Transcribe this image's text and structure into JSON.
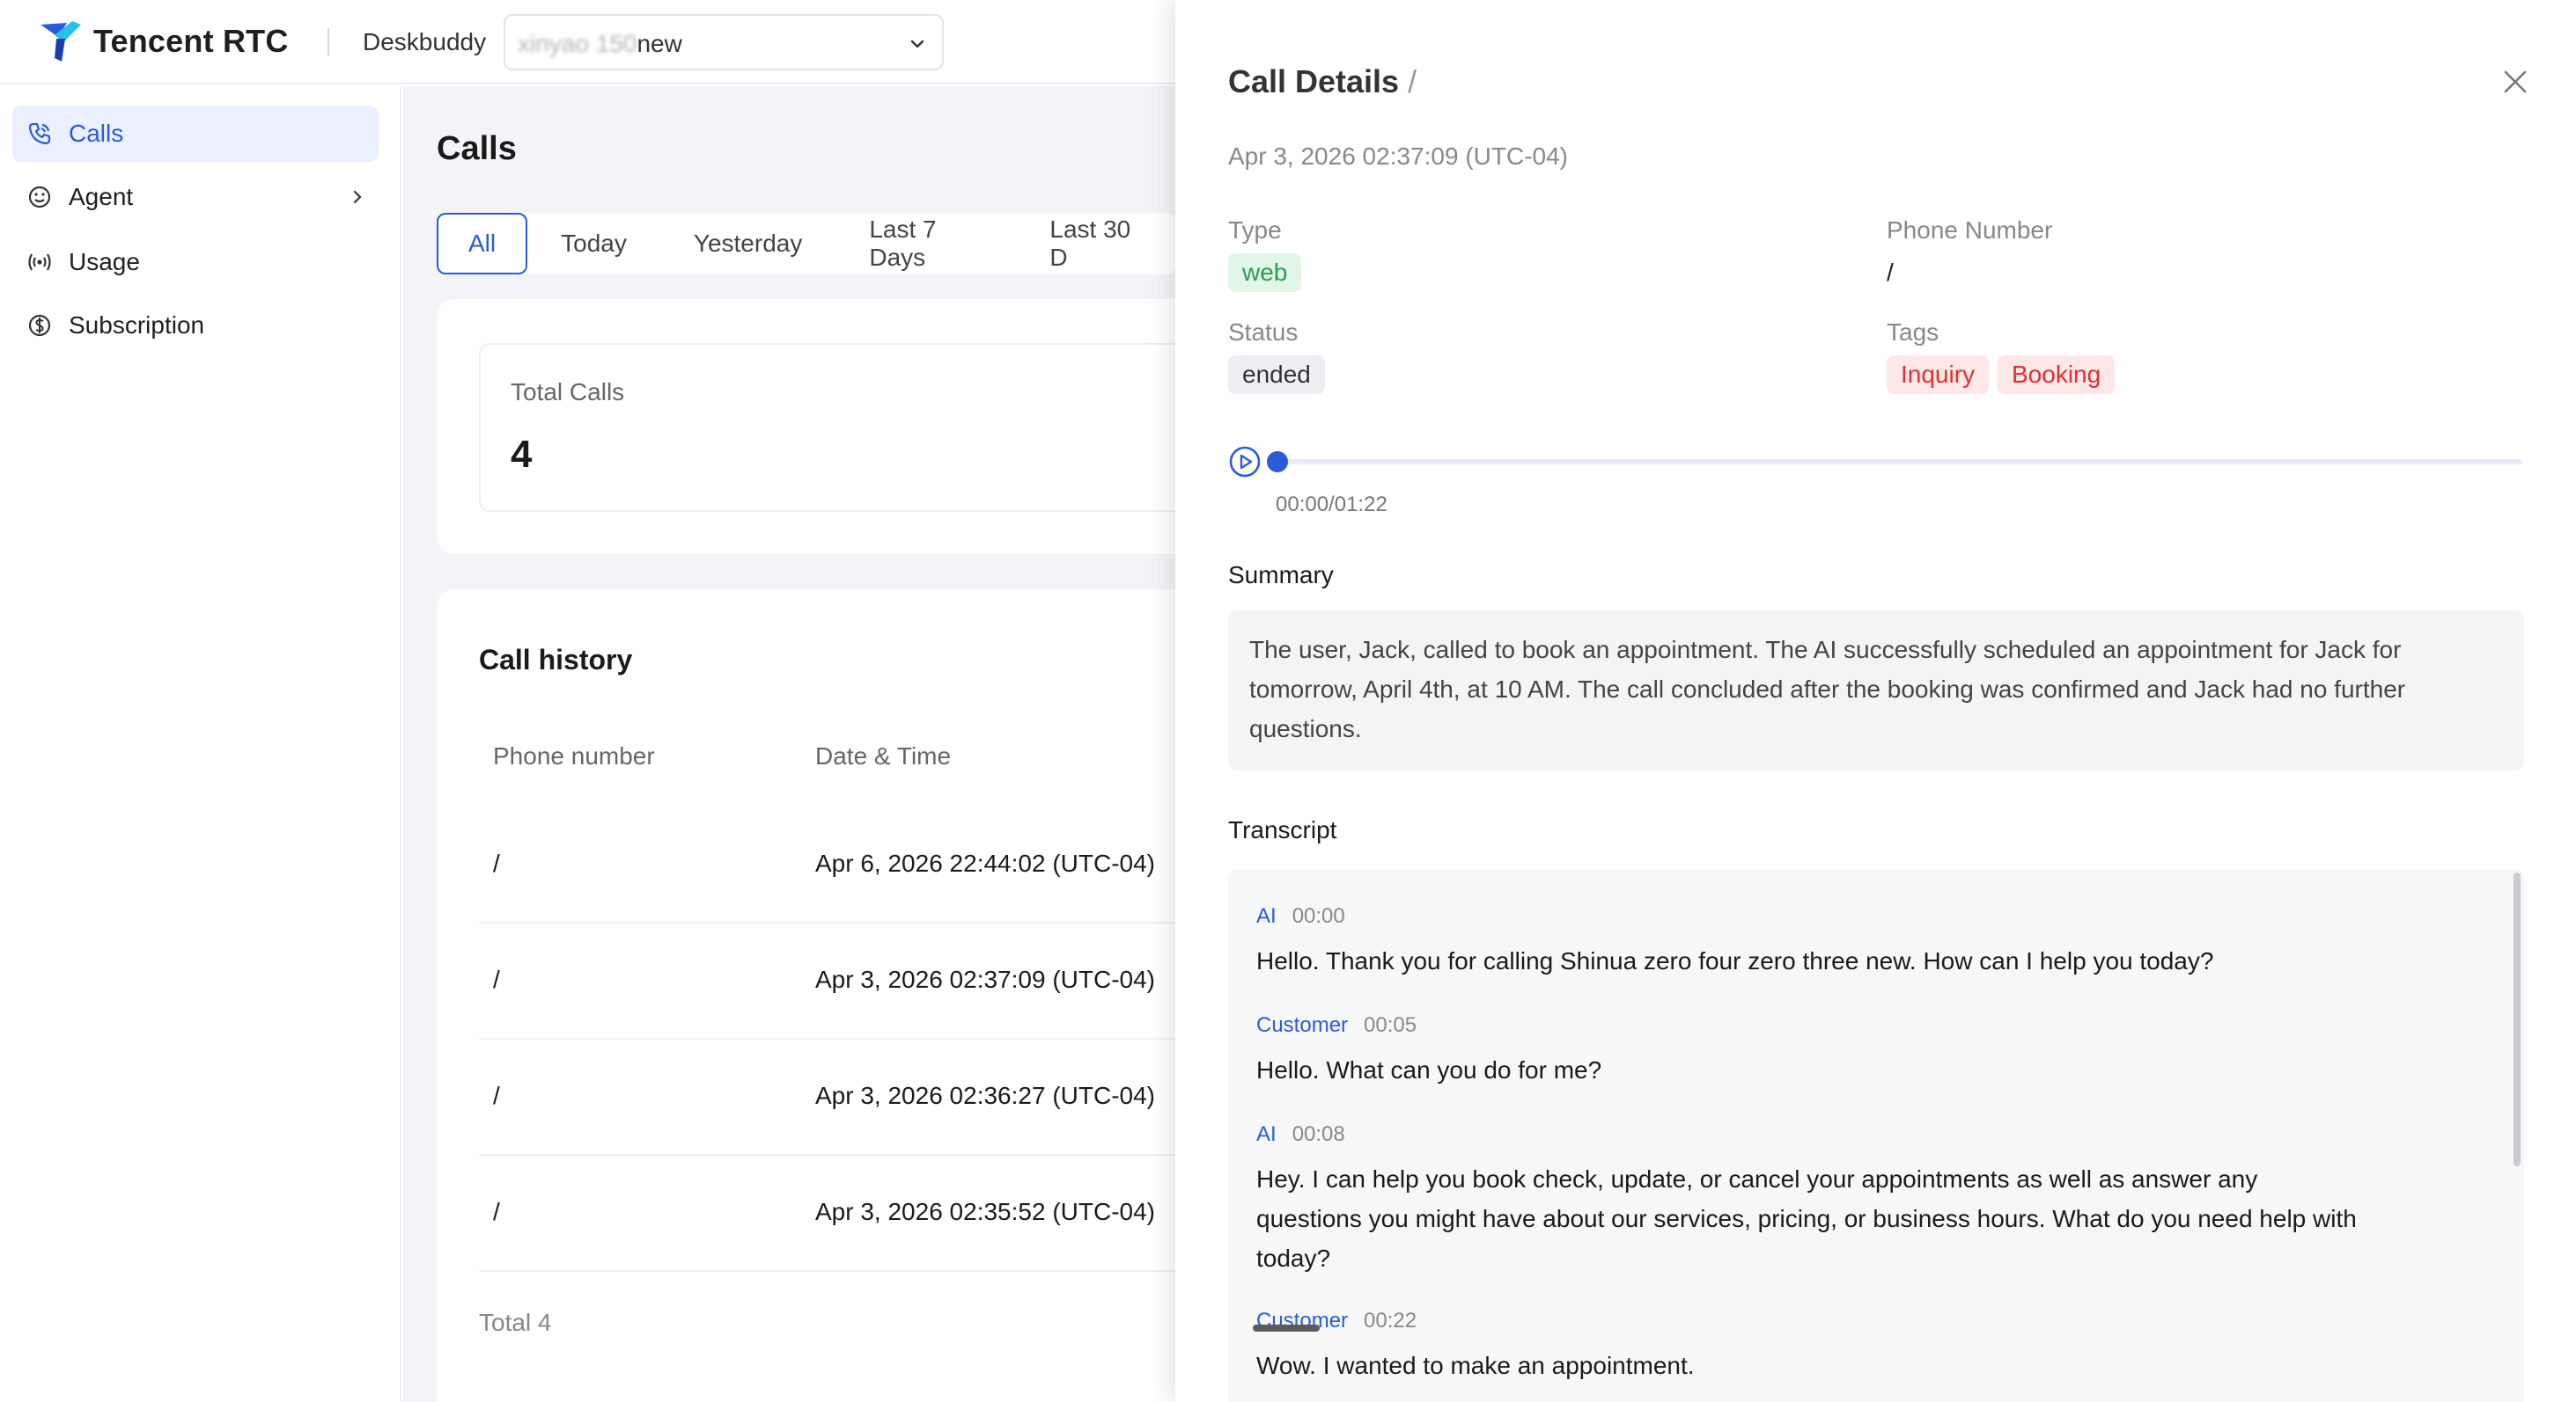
{
  "header": {
    "brand": "Tencent RTC",
    "workspace_label": "Deskbuddy",
    "workspace_value_obscured": "xinyao 150",
    "workspace_value_suffix": "new"
  },
  "sidebar": {
    "items": [
      {
        "label": "Calls",
        "icon": "phone-icon",
        "active": true
      },
      {
        "label": "Agent",
        "icon": "smiley-icon",
        "has_submenu": true
      },
      {
        "label": "Usage",
        "icon": "broadcast-icon"
      },
      {
        "label": "Subscription",
        "icon": "dollar-icon"
      }
    ]
  },
  "main": {
    "title": "Calls",
    "tabs": [
      "All",
      "Today",
      "Yesterday",
      "Last 7 Days",
      "Last 30 D"
    ],
    "active_tab": "All",
    "stats": {
      "total_calls_label": "Total Calls",
      "total_calls_value": "4"
    },
    "history": {
      "title": "Call history",
      "columns": [
        "Phone number",
        "Date & Time"
      ],
      "rows": [
        {
          "phone": "/",
          "datetime": "Apr 6, 2026 22:44:02 (UTC-04)"
        },
        {
          "phone": "/",
          "datetime": "Apr 3, 2026 02:37:09 (UTC-04)"
        },
        {
          "phone": "/",
          "datetime": "Apr 3, 2026 02:36:27 (UTC-04)"
        },
        {
          "phone": "/",
          "datetime": "Apr 3, 2026 02:35:52 (UTC-04)"
        }
      ],
      "total": "Total 4"
    }
  },
  "drawer": {
    "title": "Call Details",
    "title_suffix": "/",
    "datetime": "Apr 3, 2026 02:37:09 (UTC-04)",
    "type_label": "Type",
    "type_value": "web",
    "phone_label": "Phone Number",
    "phone_value": "/",
    "status_label": "Status",
    "status_value": "ended",
    "tags_label": "Tags",
    "tags": [
      "Inquiry",
      "Booking"
    ],
    "player": {
      "time": "00:00/01:22",
      "progress": 0
    },
    "summary_heading": "Summary",
    "summary": "The user, Jack, called to book an appointment. The AI successfully scheduled an appointment for Jack for tomorrow, April 4th, at 10 AM. The call concluded after the booking was confirmed and Jack had no further questions.",
    "transcript_heading": "Transcript",
    "transcript": [
      {
        "speaker": "AI",
        "time": "00:00",
        "text": "Hello. Thank you for calling Shinua zero four zero three new. How can I help you today?"
      },
      {
        "speaker": "Customer",
        "time": "00:05",
        "text": "Hello. What can you do for me?"
      },
      {
        "speaker": "AI",
        "time": "00:08",
        "text": "Hey. I can help you book check, update, or cancel your appointments as well as answer any questions you might have about our services, pricing, or business hours. What do you need help with today?"
      },
      {
        "speaker": "Customer",
        "time": "00:22",
        "text": "Wow. I wanted to make an appointment."
      }
    ]
  },
  "colors": {
    "accent": "#2a5bd7",
    "green": "#2a9c4e",
    "red": "#e03131"
  }
}
